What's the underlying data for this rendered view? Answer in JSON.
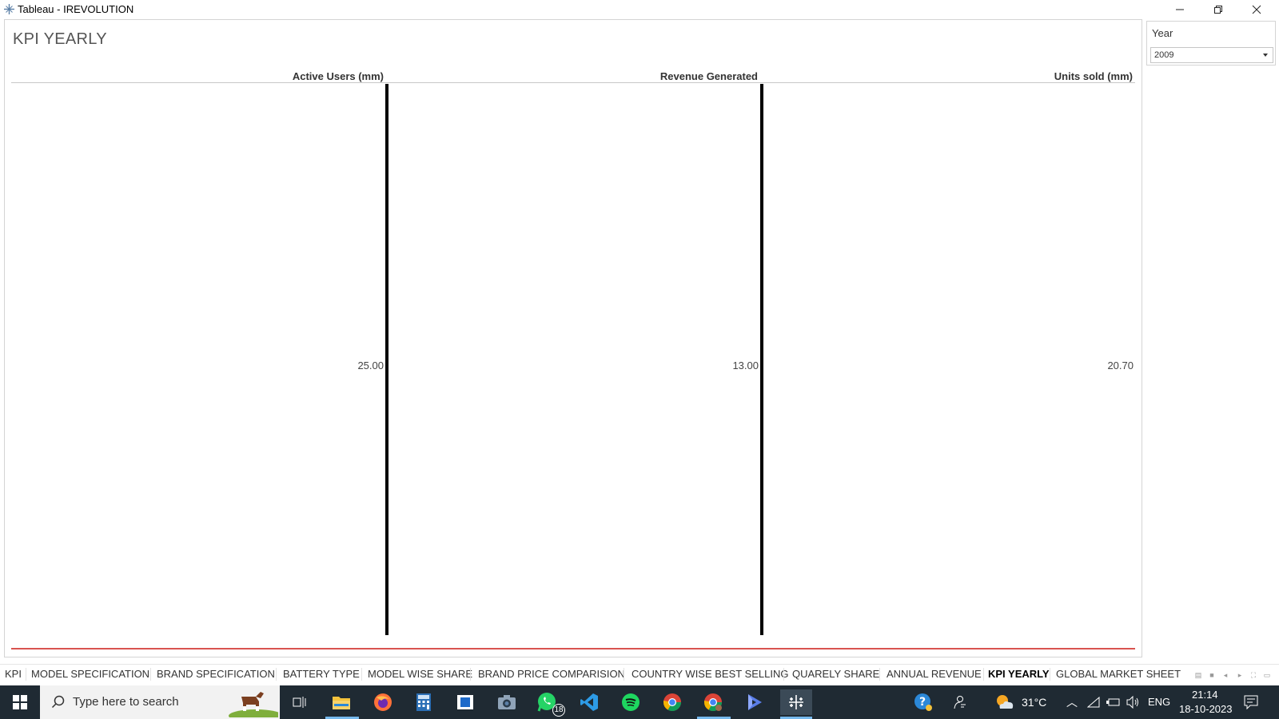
{
  "window": {
    "title": "Tableau - IREVOLUTION",
    "app_icon": "tableau-icon",
    "controls": [
      "minimize-icon",
      "restore-icon",
      "close-icon"
    ]
  },
  "dashboard": {
    "title": "KPI YEARLY",
    "kpis": [
      {
        "header": "Active Users (mm)",
        "value": "25.00"
      },
      {
        "header": "Revenue Generated",
        "value": "13.00"
      },
      {
        "header": "Units sold (mm)",
        "value": "20.70"
      }
    ]
  },
  "filter": {
    "label": "Year",
    "selected": "2009"
  },
  "sheet_tabs": [
    {
      "label": "KPI",
      "active": false
    },
    {
      "label": "MODEL SPECIFICATION",
      "active": false
    },
    {
      "label": "BRAND SPECIFICATION",
      "active": false
    },
    {
      "label": "BATTERY TYPE",
      "active": false
    },
    {
      "label": "MODEL WISE SHARE",
      "active": false
    },
    {
      "label": "BRAND PRICE COMPARISION",
      "active": false
    },
    {
      "label": "COUNTRY WISE BEST SELLING",
      "active": false
    },
    {
      "label": "QUARELY SHARE",
      "active": false
    },
    {
      "label": "ANNUAL REVENUE",
      "active": false
    },
    {
      "label": "KPI YEARLY",
      "active": true
    },
    {
      "label": "GLOBAL MARKET SHEET",
      "active": false
    }
  ],
  "taskbar": {
    "search_placeholder": "Type here to search",
    "whatsapp_badge": "18",
    "weather_temp": "31°C",
    "language": "ENG",
    "time": "21:14",
    "date": "18-10-2023"
  },
  "colors": {
    "kpi_line": "#000000",
    "base_line": "#d9534f",
    "taskbar_bg": "#1f2a33",
    "accent_underline": "#76b9ed"
  }
}
